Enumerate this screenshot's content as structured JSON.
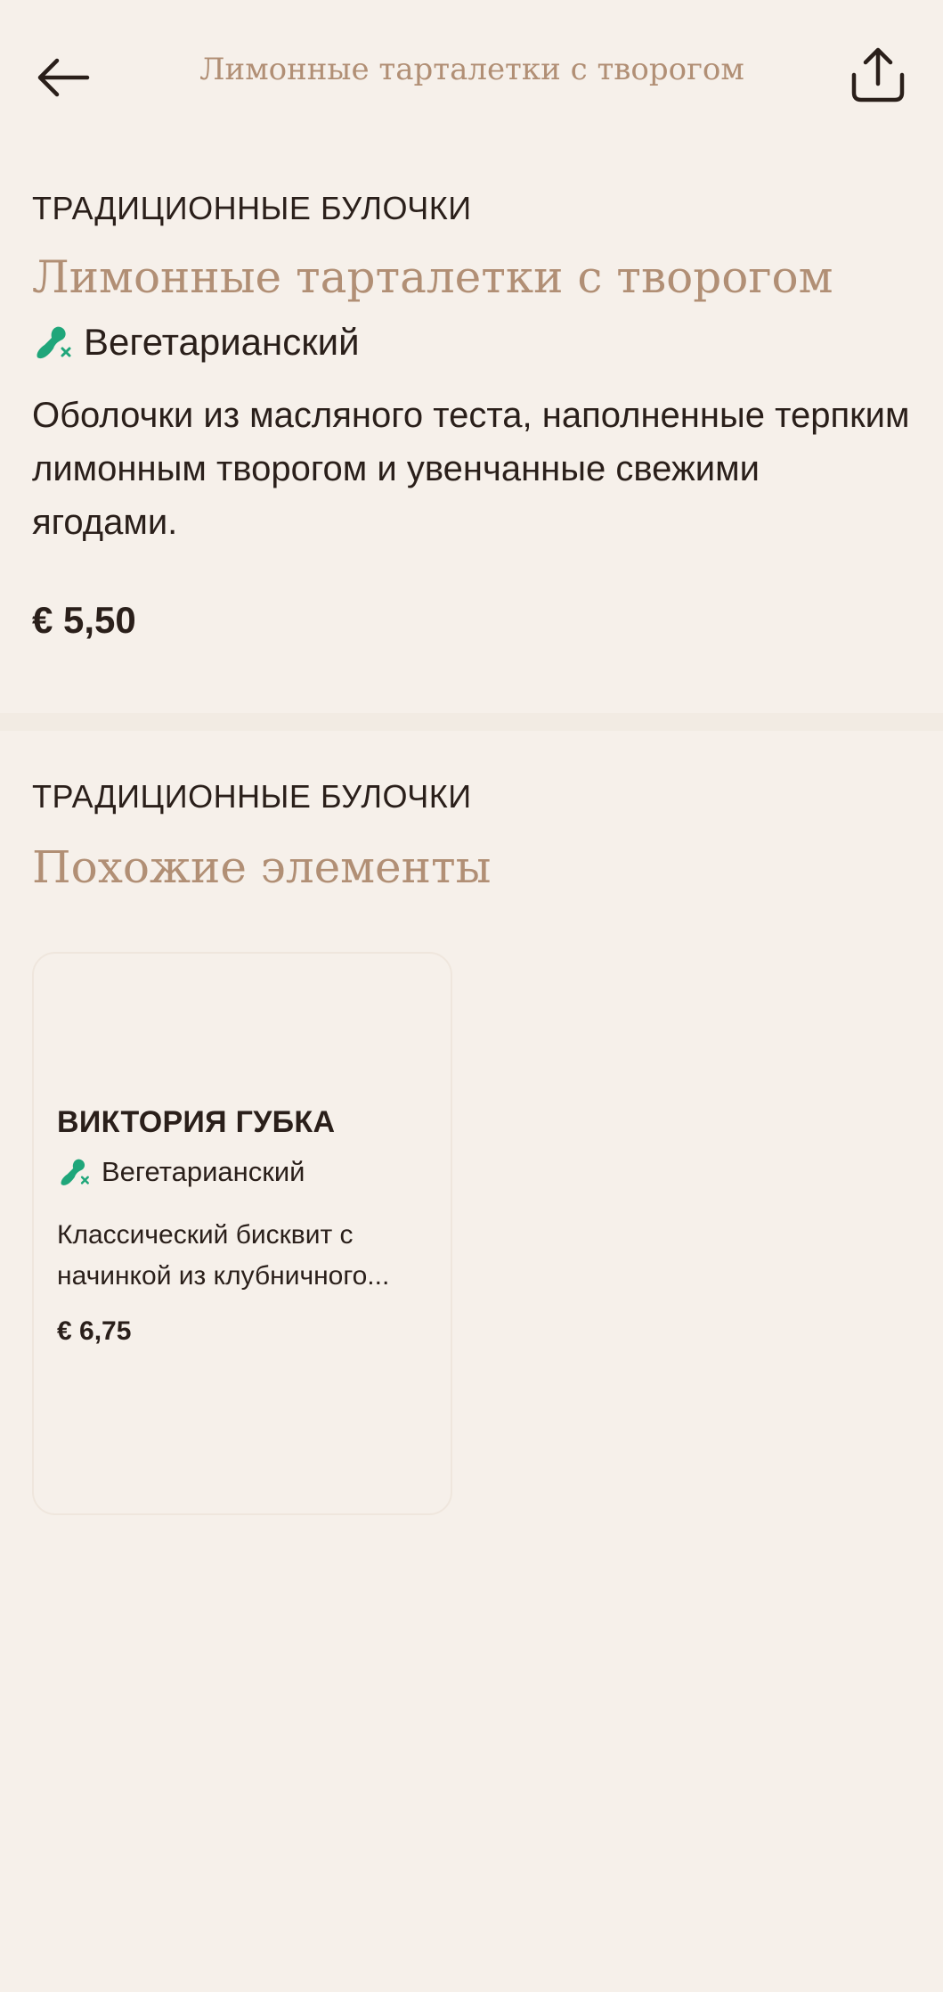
{
  "header": {
    "title": "Лимонные тарталетки с творогом",
    "back_icon": "arrow-left-icon",
    "share_icon": "share-icon"
  },
  "product": {
    "category": "ТРАДИЦИОННЫЕ БУЛОЧКИ",
    "title": "Лимонные тарталетки с творогом",
    "tag": "Вегетарианский",
    "tag_icon": "vegetarian-icon",
    "description": "Оболочки из масляного теста, наполненные терпким лимонным творогом и увенчанные свежими ягодами.",
    "price": "€ 5,50"
  },
  "related": {
    "category": "ТРАДИЦИОННЫЕ БУЛОЧКИ",
    "title": "Похожие элементы",
    "items": [
      {
        "title": "ВИКТОРИЯ ГУБКА",
        "tag": "Вегетарианский",
        "description": "Классический бисквит с начинкой из клубничного...",
        "price": "€ 6,75"
      }
    ]
  },
  "colors": {
    "background": "#f6f0ea",
    "accent": "#b18f75",
    "text": "#2a1f1a",
    "vegetarian_green": "#1fa67a"
  }
}
